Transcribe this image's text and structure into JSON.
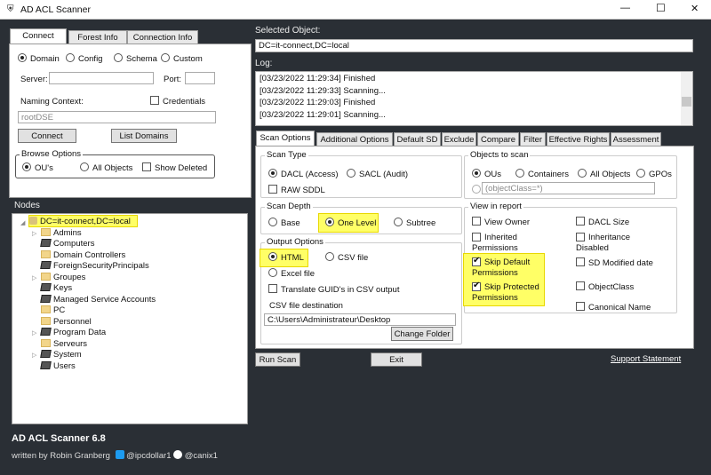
{
  "window": {
    "title": "AD ACL Scanner",
    "minimize": "—",
    "maximize": "☐",
    "close": "✕"
  },
  "connect": {
    "tabs": [
      "Connect",
      "Forest Info",
      "Connection Info"
    ],
    "modes": [
      "Domain",
      "Config",
      "Schema",
      "Custom"
    ],
    "server_label": "Server:",
    "server_value": "",
    "port_label": "Port:",
    "port_value": "",
    "naming_context_label": "Naming Context:",
    "credentials_label": "Credentials",
    "naming_context_value": "rootDSE",
    "connect_button": "Connect",
    "list_domains_button": "List Domains",
    "browse_options": {
      "label": "Browse Options",
      "ous": "OU's",
      "all_objects": "All Objects",
      "show_deleted": "Show Deleted"
    }
  },
  "nodes": {
    "label": "Nodes",
    "root": "DC=it-connect,DC=local",
    "items": [
      {
        "name": "Admins",
        "type": "folder",
        "expandable": true
      },
      {
        "name": "Computers",
        "type": "container",
        "expandable": false
      },
      {
        "name": "Domain Controllers",
        "type": "folder",
        "expandable": false
      },
      {
        "name": "ForeignSecurityPrincipals",
        "type": "container",
        "expandable": false
      },
      {
        "name": "Groupes",
        "type": "folder",
        "expandable": true
      },
      {
        "name": "Keys",
        "type": "container",
        "expandable": false
      },
      {
        "name": "Managed Service Accounts",
        "type": "container",
        "expandable": false
      },
      {
        "name": "PC",
        "type": "folder",
        "expandable": false
      },
      {
        "name": "Personnel",
        "type": "folder",
        "expandable": false
      },
      {
        "name": "Program Data",
        "type": "container",
        "expandable": true
      },
      {
        "name": "Serveurs",
        "type": "folder",
        "expandable": false
      },
      {
        "name": "System",
        "type": "container",
        "expandable": true
      },
      {
        "name": "Users",
        "type": "container",
        "expandable": false
      }
    ]
  },
  "footer": {
    "title": "AD ACL Scanner 6.8",
    "written_by": "written by Robin Granberg",
    "twitter": "@ipcdollar1",
    "github": "@canix1"
  },
  "selected_object": {
    "label": "Selected Object:",
    "value": "DC=it-connect,DC=local"
  },
  "log": {
    "label": "Log:",
    "lines": [
      "[03/23/2022 11:29:34] Finished",
      "[03/23/2022 11:29:33] Scanning...",
      "[03/23/2022 11:29:03] Finished",
      "[03/23/2022 11:29:01] Scanning..."
    ]
  },
  "scan_tabs": [
    "Scan Options",
    "Additional Options",
    "Default SD",
    "Exclude",
    "Compare",
    "Filter",
    "Effective Rights",
    "Assessment"
  ],
  "scan_type": {
    "label": "Scan Type",
    "dacl": "DACL (Access)",
    "sacl": "SACL (Audit)",
    "raw_sddl": "RAW SDDL"
  },
  "scan_depth": {
    "label": "Scan Depth",
    "base": "Base",
    "one_level": "One Level",
    "subtree": "Subtree"
  },
  "output": {
    "label": "Output Options",
    "html": "HTML",
    "csv": "CSV file",
    "excel": "Excel file",
    "translate_guid": "Translate GUID's in CSV output",
    "csv_dest_label": "CSV file destination",
    "csv_dest_value": "C:\\Users\\Administrateur\\Desktop",
    "change_folder": "Change Folder"
  },
  "objects_to_scan": {
    "label": "Objects to scan",
    "ous": "OUs",
    "containers": "Containers",
    "all_objects": "All Objects",
    "gpos": "GPOs",
    "filter_value": "(objectClass=*)"
  },
  "view_in_report": {
    "label": "View in report",
    "view_owner": "View Owner",
    "inherited": "Inherited Permissions",
    "skip_default": "Skip Default Permissions",
    "skip_protected": "Skip Protected Permissions",
    "dacl_size": "DACL Size",
    "inheritance_disabled": "Inheritance Disabled",
    "sd_modified": "SD Modified date",
    "object_class": "ObjectClass",
    "canonical_name": "Canonical Name"
  },
  "actions": {
    "run_scan": "Run Scan",
    "exit": "Exit",
    "support": "Support Statement"
  },
  "colors": {
    "background": "#2a2f35",
    "highlight": "#ffff66"
  }
}
